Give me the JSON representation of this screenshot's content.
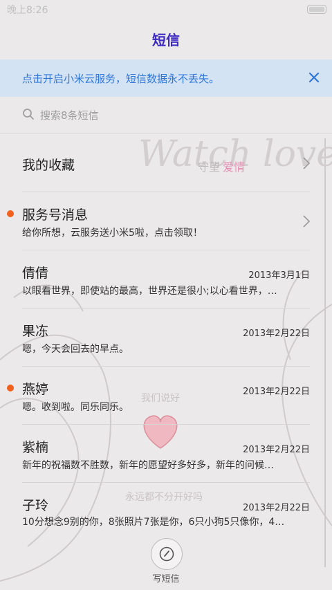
{
  "status_bar": {
    "time": "晚上8:26"
  },
  "header": {
    "title": "短信"
  },
  "banner": {
    "text": "点击开启小米云服务，短信数据永不丢失。"
  },
  "search": {
    "placeholder": "搜索8条短信"
  },
  "wallpaper": {
    "script": "Watch love",
    "caption_plain": "守望",
    "caption_colored": "爱情",
    "phrase1": "我们说好",
    "phrase2": "永远都不分开好吗"
  },
  "conversations": [
    {
      "name": "我的收藏",
      "message": "",
      "date": "",
      "unread": false
    },
    {
      "name": "服务号消息",
      "message": "给你所想，云服务送小米5啦，点击领取！",
      "date": "",
      "unread": true
    },
    {
      "name": "倩倩",
      "message": "以眼看世界，即使站的最高，世界还是很小;以心看世界，…",
      "date": "2013年3月1日",
      "unread": false
    },
    {
      "name": "果冻",
      "message": "嗯，今天会回去的早点。",
      "date": "2013年2月22日",
      "unread": false
    },
    {
      "name": "燕婷",
      "message": "嗯。收到啦。同乐同乐。",
      "date": "2013年2月22日",
      "unread": true
    },
    {
      "name": "紫楠",
      "message": "新年的祝福数不胜数，新年的愿望好多好多，新年的问候…",
      "date": "2013年2月22日",
      "unread": false
    },
    {
      "name": "子玲",
      "message": "10分想念9别的你，8张照片7张是你，6只小狗5只像你，4…",
      "date": "2013年2月22日",
      "unread": false
    }
  ],
  "compose": {
    "label": "写短信"
  },
  "colors": {
    "title": "#3d2ac2",
    "banner_bg": "#d3e3f4",
    "banner_text": "#3077d8",
    "unread_dot": "#f2601e"
  }
}
